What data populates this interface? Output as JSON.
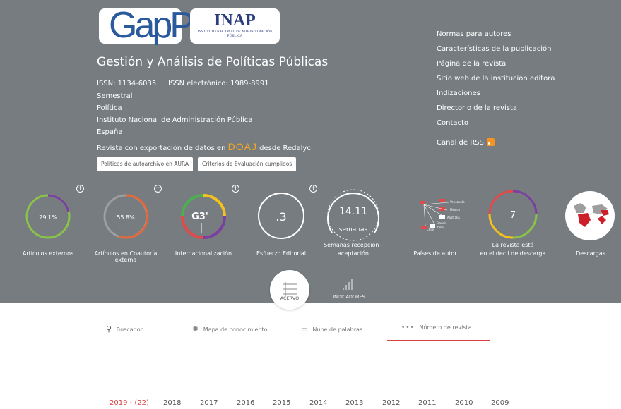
{
  "logos": {
    "gapp": "GapP",
    "inap_main": "INAP",
    "inap_sub": "INSTITUTO NACIONAL DE ADMINISTRACIÓN PÚBLICA"
  },
  "journal": {
    "title": "Gestión y Análisis de Políticas Públicas",
    "issn": "ISSN: 1134-6035",
    "eissn": "ISSN electrónico: 1989-8991",
    "frequency": "Semestral",
    "area": "Política",
    "institution": "Instituto Nacional de Administración Pública",
    "country": "España",
    "export_prefix": "Revista con exportación de datos en",
    "doaj": "DOAJ",
    "export_suffix": "desde Redalyc"
  },
  "buttons": {
    "aura": "Políticas de autoarchivo en AURA",
    "criteria": "Criterios de Evaluación cumplidos"
  },
  "right_links": [
    "Normas para autores",
    "Características de la publicación",
    "Página de la revista",
    "Sitio web de la institución editora",
    "Indizaciones",
    "Directorio de la revista",
    "Contacto"
  ],
  "rss_label": "Canal de RSS",
  "metrics": {
    "external": {
      "value": "29.1%",
      "label": "Artículos externos"
    },
    "coauthor": {
      "value": "55.8%",
      "label": "Artículos en Coautoría externa"
    },
    "intl": {
      "value": "G3'",
      "label": "Internacionalización"
    },
    "editorial": {
      "value": ".3",
      "label": "Esfuerzo Editorial"
    },
    "weeks": {
      "value": "14.11",
      "unit": "semanas",
      "label1": "Semanas recepción -",
      "label2": "aceptación"
    },
    "countries": {
      "label": "Países de autor",
      "items": [
        "Venezuela",
        "México",
        "Australia",
        "Francia",
        "Chile",
        "Italia"
      ]
    },
    "decile": {
      "value": "7",
      "label1": "La revista está",
      "label2": "en el decil de descarga"
    },
    "downloads": {
      "label": "Descargas"
    }
  },
  "tabs": {
    "acervo": "ACERVO",
    "indicadores": "INDICADORES"
  },
  "nav": {
    "search": "Buscador",
    "map": "Mapa de conocimiento",
    "cloud": "Nube de palabras",
    "issue": "Número de revista"
  },
  "years": [
    "2019 - (22)",
    "2018",
    "2017",
    "2016",
    "2015",
    "2014",
    "2013",
    "2012",
    "2011",
    "2010",
    "2009"
  ],
  "colors": {
    "header_bg": "#767c80",
    "accent_red": "#d94545",
    "doaj_orange": "#f5a623"
  }
}
